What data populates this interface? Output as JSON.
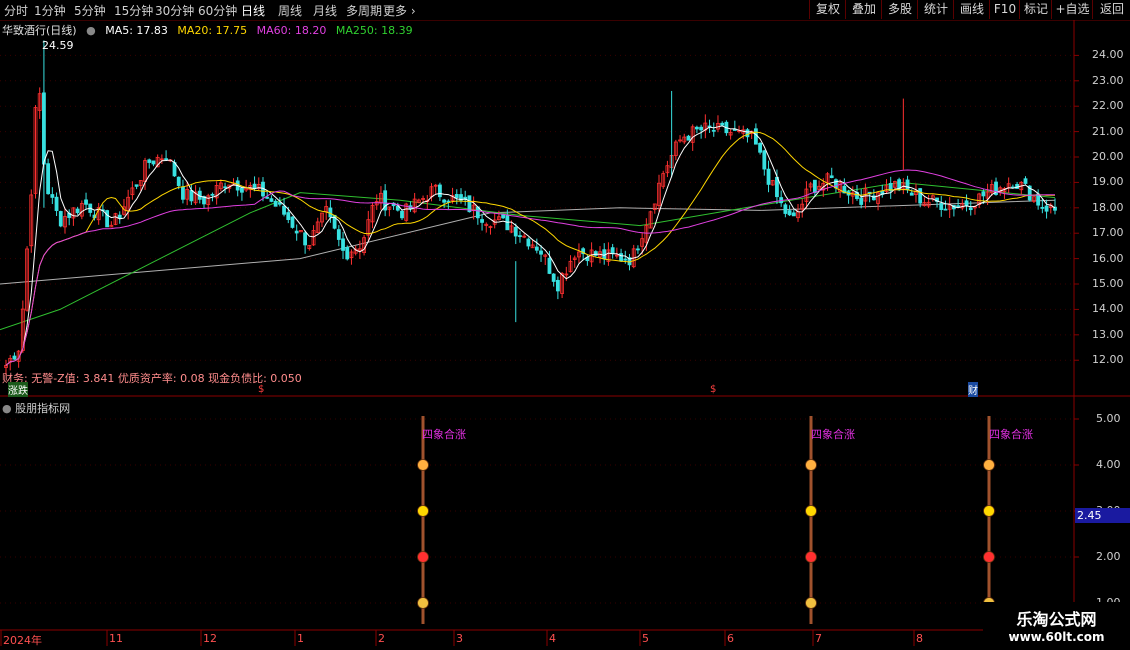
{
  "toolbar": {
    "timeframes": [
      "分时",
      "1分钟",
      "5分钟",
      "15分钟",
      "30分钟",
      "60分钟",
      "日线",
      "周线",
      "月线",
      "多周期",
      "更多"
    ],
    "active": "日线",
    "buttons": [
      "复权",
      "叠加",
      "多股",
      "统计",
      "画线",
      "F10",
      "标记",
      "+自选",
      "返回"
    ]
  },
  "header": {
    "stock": "华致酒行(日线)",
    "ma": [
      {
        "label": "MA5: 17.83",
        "color": "#ffffff"
      },
      {
        "label": "MA20: 17.75",
        "color": "#ffd700"
      },
      {
        "label": "MA60: 18.20",
        "color": "#e040e0"
      },
      {
        "label": "MA250: 18.39",
        "color": "#30d030"
      }
    ],
    "peak_label": "24.59"
  },
  "price_axis": [
    "24.00",
    "23.00",
    "22.00",
    "21.00",
    "20.00",
    "19.00",
    "18.00",
    "17.00",
    "16.00",
    "15.00",
    "14.00",
    "13.00",
    "12.00"
  ],
  "alert_text": "财务: 无警-Z值: 3.841 优质资产率: 0.08 现金负债比: 0.050",
  "markers": {
    "left": "涨跌",
    "dollar": "$",
    "cai": "财"
  },
  "indicator": {
    "title": "股朋指标网",
    "axis": [
      "5.00",
      "4.00",
      "3.00",
      "2.00",
      "1.00"
    ],
    "current_value": "2.45",
    "signal_label": "四象合涨"
  },
  "dates": [
    "2024年",
    "11",
    "12",
    "1",
    "2",
    "3",
    "4",
    "5",
    "6",
    "7",
    "8"
  ],
  "watermark": {
    "line1": "乐淘公式网",
    "line2": "www.60lt.com"
  },
  "chart_data": {
    "type": "candlestick",
    "ylim": [
      11.3,
      25.0
    ],
    "indicator_ylim": [
      0.5,
      5.5
    ],
    "signal_levels": [
      4.0,
      3.0,
      2.0,
      1.0
    ],
    "signal_positions": [
      "2月下旬",
      "6月下旬",
      "8月中旬"
    ]
  }
}
